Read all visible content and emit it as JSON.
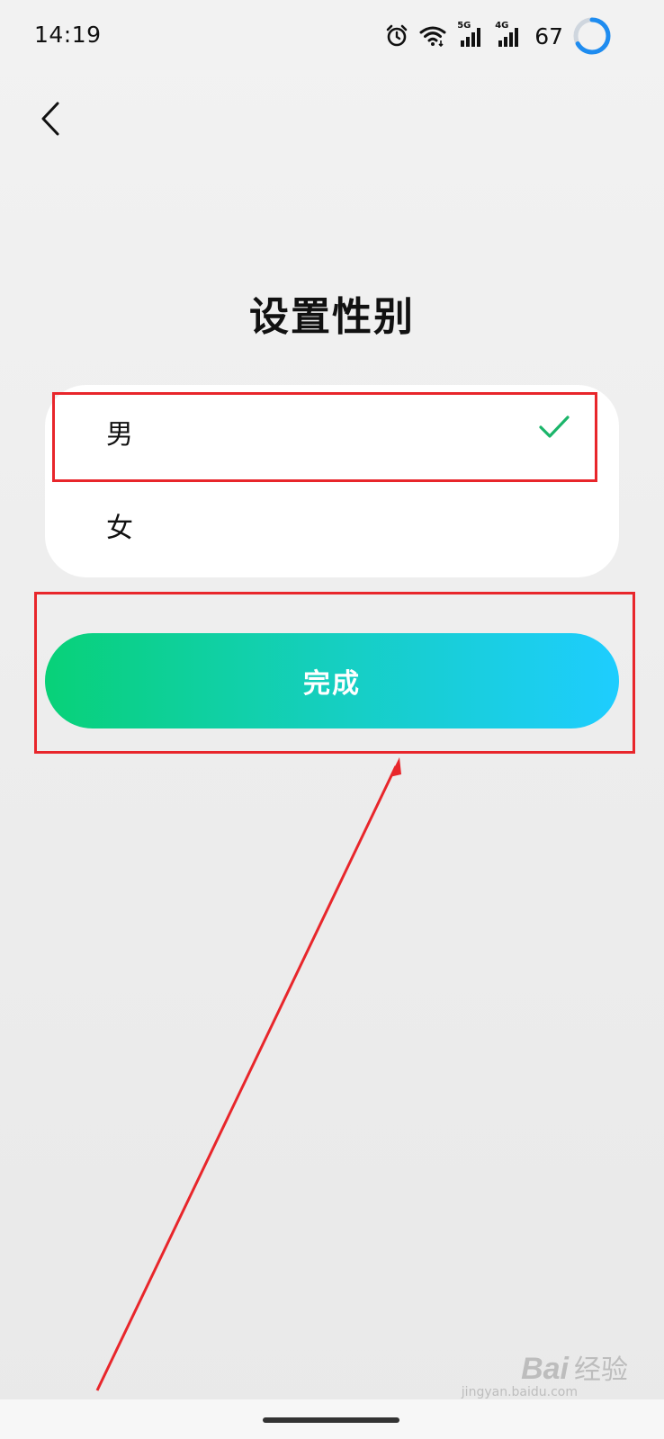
{
  "status_bar": {
    "time": "14:19",
    "battery": "67",
    "icons": [
      "alarm-icon",
      "wifi-icon",
      "signal-5g-icon",
      "signal-4g-icon",
      "battery-ring-icon"
    ],
    "signal_5g_label": "5G",
    "signal_4g_label": "4G"
  },
  "header": {
    "back_icon": "chevron-left-icon",
    "title": "设置性别"
  },
  "gender_options": [
    {
      "label": "男",
      "selected": true
    },
    {
      "label": "女",
      "selected": false
    }
  ],
  "done_button": {
    "label": "完成"
  },
  "annotations": {
    "color": "#e8262b"
  },
  "watermark": {
    "logo": "Bai",
    "suffix": "经验",
    "sub": "jingyan.baidu.com"
  },
  "colors": {
    "accent_green": "#08d178",
    "accent_blue": "#1ecdff",
    "check_green": "#1bb56a",
    "battery_ring": "#1e8cf0"
  }
}
